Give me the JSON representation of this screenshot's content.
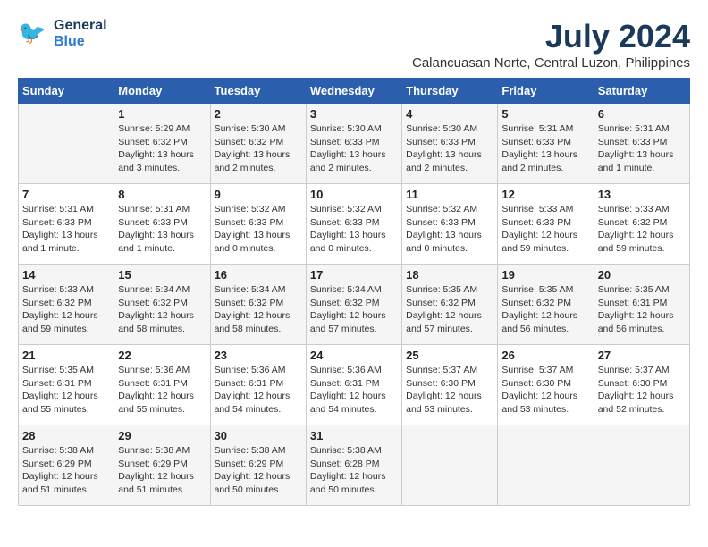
{
  "logo": {
    "line1": "General",
    "line2": "Blue"
  },
  "title": "July 2024",
  "location": "Calancuasan Norte, Central Luzon, Philippines",
  "header": {
    "days": [
      "Sunday",
      "Monday",
      "Tuesday",
      "Wednesday",
      "Thursday",
      "Friday",
      "Saturday"
    ]
  },
  "weeks": [
    {
      "cells": [
        {
          "day": "",
          "content": ""
        },
        {
          "day": "1",
          "content": "Sunrise: 5:29 AM\nSunset: 6:32 PM\nDaylight: 13 hours\nand 3 minutes."
        },
        {
          "day": "2",
          "content": "Sunrise: 5:30 AM\nSunset: 6:32 PM\nDaylight: 13 hours\nand 2 minutes."
        },
        {
          "day": "3",
          "content": "Sunrise: 5:30 AM\nSunset: 6:33 PM\nDaylight: 13 hours\nand 2 minutes."
        },
        {
          "day": "4",
          "content": "Sunrise: 5:30 AM\nSunset: 6:33 PM\nDaylight: 13 hours\nand 2 minutes."
        },
        {
          "day": "5",
          "content": "Sunrise: 5:31 AM\nSunset: 6:33 PM\nDaylight: 13 hours\nand 2 minutes."
        },
        {
          "day": "6",
          "content": "Sunrise: 5:31 AM\nSunset: 6:33 PM\nDaylight: 13 hours\nand 1 minute."
        }
      ]
    },
    {
      "cells": [
        {
          "day": "7",
          "content": "Sunrise: 5:31 AM\nSunset: 6:33 PM\nDaylight: 13 hours\nand 1 minute."
        },
        {
          "day": "8",
          "content": "Sunrise: 5:31 AM\nSunset: 6:33 PM\nDaylight: 13 hours\nand 1 minute."
        },
        {
          "day": "9",
          "content": "Sunrise: 5:32 AM\nSunset: 6:33 PM\nDaylight: 13 hours\nand 0 minutes."
        },
        {
          "day": "10",
          "content": "Sunrise: 5:32 AM\nSunset: 6:33 PM\nDaylight: 13 hours\nand 0 minutes."
        },
        {
          "day": "11",
          "content": "Sunrise: 5:32 AM\nSunset: 6:33 PM\nDaylight: 13 hours\nand 0 minutes."
        },
        {
          "day": "12",
          "content": "Sunrise: 5:33 AM\nSunset: 6:33 PM\nDaylight: 12 hours\nand 59 minutes."
        },
        {
          "day": "13",
          "content": "Sunrise: 5:33 AM\nSunset: 6:32 PM\nDaylight: 12 hours\nand 59 minutes."
        }
      ]
    },
    {
      "cells": [
        {
          "day": "14",
          "content": "Sunrise: 5:33 AM\nSunset: 6:32 PM\nDaylight: 12 hours\nand 59 minutes."
        },
        {
          "day": "15",
          "content": "Sunrise: 5:34 AM\nSunset: 6:32 PM\nDaylight: 12 hours\nand 58 minutes."
        },
        {
          "day": "16",
          "content": "Sunrise: 5:34 AM\nSunset: 6:32 PM\nDaylight: 12 hours\nand 58 minutes."
        },
        {
          "day": "17",
          "content": "Sunrise: 5:34 AM\nSunset: 6:32 PM\nDaylight: 12 hours\nand 57 minutes."
        },
        {
          "day": "18",
          "content": "Sunrise: 5:35 AM\nSunset: 6:32 PM\nDaylight: 12 hours\nand 57 minutes."
        },
        {
          "day": "19",
          "content": "Sunrise: 5:35 AM\nSunset: 6:32 PM\nDaylight: 12 hours\nand 56 minutes."
        },
        {
          "day": "20",
          "content": "Sunrise: 5:35 AM\nSunset: 6:31 PM\nDaylight: 12 hours\nand 56 minutes."
        }
      ]
    },
    {
      "cells": [
        {
          "day": "21",
          "content": "Sunrise: 5:35 AM\nSunset: 6:31 PM\nDaylight: 12 hours\nand 55 minutes."
        },
        {
          "day": "22",
          "content": "Sunrise: 5:36 AM\nSunset: 6:31 PM\nDaylight: 12 hours\nand 55 minutes."
        },
        {
          "day": "23",
          "content": "Sunrise: 5:36 AM\nSunset: 6:31 PM\nDaylight: 12 hours\nand 54 minutes."
        },
        {
          "day": "24",
          "content": "Sunrise: 5:36 AM\nSunset: 6:31 PM\nDaylight: 12 hours\nand 54 minutes."
        },
        {
          "day": "25",
          "content": "Sunrise: 5:37 AM\nSunset: 6:30 PM\nDaylight: 12 hours\nand 53 minutes."
        },
        {
          "day": "26",
          "content": "Sunrise: 5:37 AM\nSunset: 6:30 PM\nDaylight: 12 hours\nand 53 minutes."
        },
        {
          "day": "27",
          "content": "Sunrise: 5:37 AM\nSunset: 6:30 PM\nDaylight: 12 hours\nand 52 minutes."
        }
      ]
    },
    {
      "cells": [
        {
          "day": "28",
          "content": "Sunrise: 5:38 AM\nSunset: 6:29 PM\nDaylight: 12 hours\nand 51 minutes."
        },
        {
          "day": "29",
          "content": "Sunrise: 5:38 AM\nSunset: 6:29 PM\nDaylight: 12 hours\nand 51 minutes."
        },
        {
          "day": "30",
          "content": "Sunrise: 5:38 AM\nSunset: 6:29 PM\nDaylight: 12 hours\nand 50 minutes."
        },
        {
          "day": "31",
          "content": "Sunrise: 5:38 AM\nSunset: 6:28 PM\nDaylight: 12 hours\nand 50 minutes."
        },
        {
          "day": "",
          "content": ""
        },
        {
          "day": "",
          "content": ""
        },
        {
          "day": "",
          "content": ""
        }
      ]
    }
  ]
}
